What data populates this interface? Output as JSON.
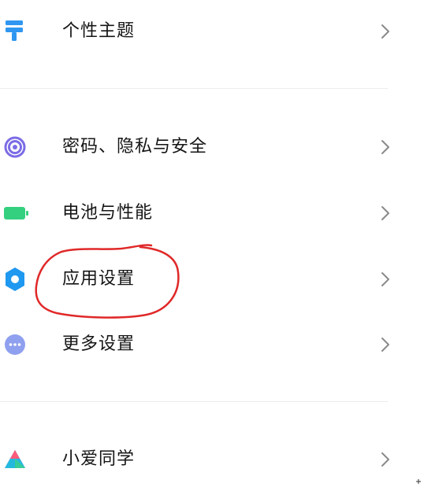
{
  "settings": {
    "items": [
      {
        "label": "个性主题",
        "icon": "theme-brush-icon",
        "color": "#2f97f1"
      },
      {
        "label": "密码、隐私与安全",
        "icon": "fingerprint-icon",
        "color": "#7b6ce6"
      },
      {
        "label": "电池与性能",
        "icon": "battery-icon",
        "color": "#34d07f"
      },
      {
        "label": "应用设置",
        "icon": "gear-icon",
        "color": "#1f98f0"
      },
      {
        "label": "更多设置",
        "icon": "more-dots-icon",
        "color": "#8fa0ef"
      },
      {
        "label": "小爱同学",
        "icon": "xiaoai-icon",
        "color": "#2a6bf2"
      }
    ]
  },
  "annotation": {
    "color": "#e02828",
    "target": "应用设置"
  },
  "colors": {
    "chevron": "#8a8a8a",
    "divider": "#ededed",
    "text": "#151515"
  }
}
